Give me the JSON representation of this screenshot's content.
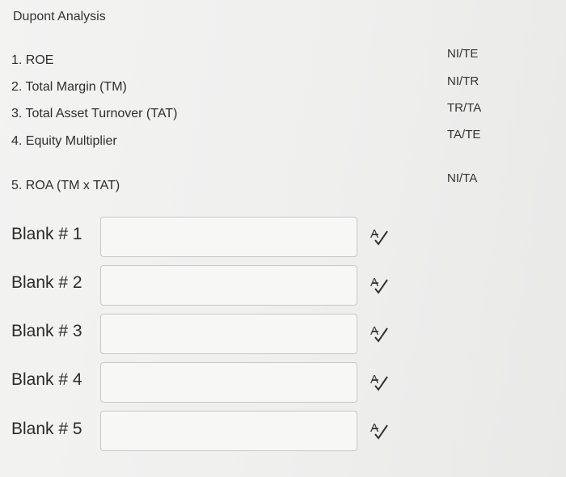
{
  "header": {
    "title": "Dupont Analysis"
  },
  "items": [
    {
      "label": "1. ROE"
    },
    {
      "label": "2. Total Margin (TM)"
    },
    {
      "label": "3. Total Asset Turnover (TAT)"
    },
    {
      "label": "4. Equity Multiplier"
    },
    {
      "label": "5. ROA (TM x TAT)"
    }
  ],
  "formulas": [
    {
      "text": "NI/TE"
    },
    {
      "text": "NI/TR"
    },
    {
      "text": "TR/TA"
    },
    {
      "text": "TA/TE"
    },
    {
      "text": "NI/TA"
    }
  ],
  "blanks": [
    {
      "label": "Blank # 1",
      "value": "",
      "icon": "spell-check-icon"
    },
    {
      "label": "Blank # 2",
      "value": "",
      "icon": "spell-check-icon"
    },
    {
      "label": "Blank # 3",
      "value": "",
      "icon": "spell-check-icon"
    },
    {
      "label": "Blank # 4",
      "value": "",
      "icon": "spell-check-icon"
    },
    {
      "label": "Blank # 5",
      "value": "",
      "icon": "spell-check-icon"
    }
  ]
}
